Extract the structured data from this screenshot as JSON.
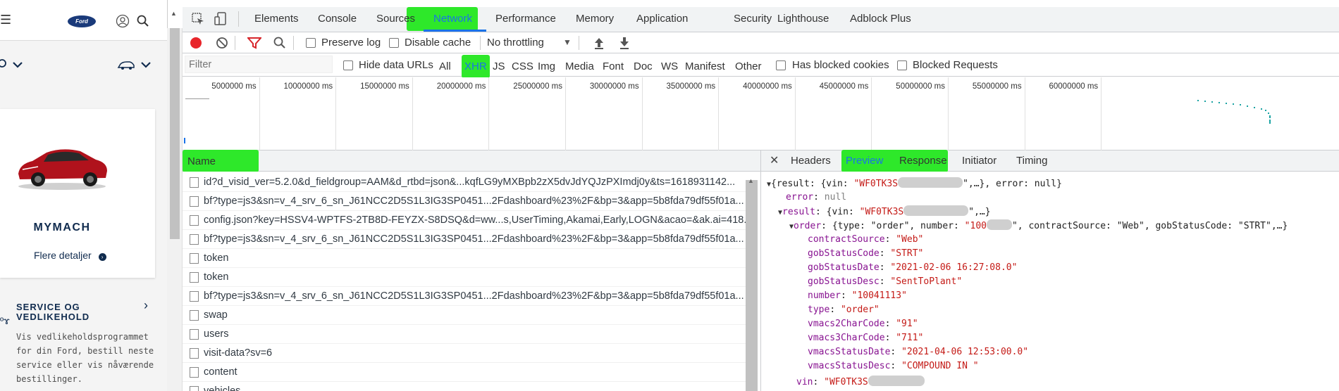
{
  "ford": {
    "logo": "Ford",
    "car_name": "MYMACH",
    "car_details": "Flere detaljer",
    "service_title": "SERVICE OG VEDLIKEHOLD",
    "service_body": "Vis vedlikeholdsprogrammet for din Ford, bestill neste service eller vis nåværende bestillinger."
  },
  "tabs": [
    "Elements",
    "Console",
    "Sources",
    "Network",
    "Performance",
    "Memory",
    "Application",
    "Security",
    "Lighthouse",
    "Adblock Plus"
  ],
  "active_tab": "Network",
  "toolbar": {
    "preserve_log": "Preserve log",
    "disable_cache": "Disable cache",
    "throttling": "No throttling"
  },
  "filter": {
    "placeholder": "Filter",
    "hide_data_urls": "Hide data URLs",
    "types": [
      "All",
      "XHR",
      "JS",
      "CSS",
      "Img",
      "Media",
      "Font",
      "Doc",
      "WS",
      "Manifest",
      "Other"
    ],
    "selected_type": "XHR",
    "has_blocked_cookies": "Has blocked cookies",
    "blocked_requests": "Blocked Requests"
  },
  "timeline": {
    "ticks": [
      "5000000 ms",
      "10000000 ms",
      "15000000 ms",
      "20000000 ms",
      "25000000 ms",
      "30000000 ms",
      "35000000 ms",
      "40000000 ms",
      "45000000 ms",
      "50000000 ms",
      "55000000 ms",
      "60000000 ms"
    ]
  },
  "requests": {
    "column_name": "Name",
    "rows": [
      "id?d_visid_ver=5.2.0&d_fieldgroup=AAM&d_rtbd=json&...kqfLG9yMXBpb2zX5dvJdYQJzPXImdj0y&ts=1618931142...",
      "bf?type=js3&sn=v_4_srv_6_sn_J61NCC2D5S1L3IG3SP0451...2Fdashboard%23%2F&bp=3&app=5b8fda79df55f01a...",
      "config.json?key=HSSV4-WPTFS-2TB8D-FEYZX-S8DSQ&d=ww...s,UserTiming,Akamai,Early,LOGN&acao=&ak.ai=418...",
      "bf?type=js3&sn=v_4_srv_6_sn_J61NCC2D5S1L3IG3SP0451...2Fdashboard%23%2F&bp=3&app=5b8fda79df55f01a...",
      "token",
      "token",
      "bf?type=js3&sn=v_4_srv_6_sn_J61NCC2D5S1L3IG3SP0451...2Fdashboard%23%2F&bp=3&app=5b8fda79df55f01a...",
      "swap",
      "users",
      "visit-data?sv=6",
      "content",
      "vehicles"
    ]
  },
  "detail_tabs": [
    "Headers",
    "Preview",
    "Response",
    "Initiator",
    "Timing"
  ],
  "active_detail_tab": "Preview",
  "preview": {
    "l1_a": "{result: {vin: ",
    "l1_vin": "\"WF0TK3S",
    "l1_b": "\",…}, error: null}",
    "error_key": "error",
    "error_val": "null",
    "result_key": "result",
    "result_a": "{vin: ",
    "result_vin": "\"WF0TK3S",
    "result_b": "\",…}",
    "order_key": "order",
    "order_a": "{type: \"order\", number: ",
    "order_num": "\"100",
    "order_b": "\", contractSource: \"Web\", gobStatusCode: \"STRT\",…}",
    "fields": [
      {
        "k": "contractSource",
        "v": "\"Web\""
      },
      {
        "k": "gobStatusCode",
        "v": "\"STRT\""
      },
      {
        "k": "gobStatusDate",
        "v": "\"2021-02-06 16:27:08.0\""
      },
      {
        "k": "gobStatusDesc",
        "v": "\"SentToPlant\""
      },
      {
        "k": "number",
        "v": "\"10041113\""
      },
      {
        "k": "type",
        "v": "\"order\""
      },
      {
        "k": "vmacs2CharCode",
        "v": "\"91\""
      },
      {
        "k": "vmacs3CharCode",
        "v": "\"711\""
      },
      {
        "k": "vmacsStatusDate",
        "v": "\"2021-04-06 12:53:00.0\""
      },
      {
        "k": "vmacsStatusDesc",
        "v": "\"COMPOUND IN \""
      }
    ],
    "vin_key": "vin",
    "vin_val": "\"WF0TK3S"
  },
  "colors": {
    "highlight": "#2ee82a",
    "accent": "#1a73e8",
    "record": "#e8252b",
    "filter_icon": "#d7262b"
  }
}
